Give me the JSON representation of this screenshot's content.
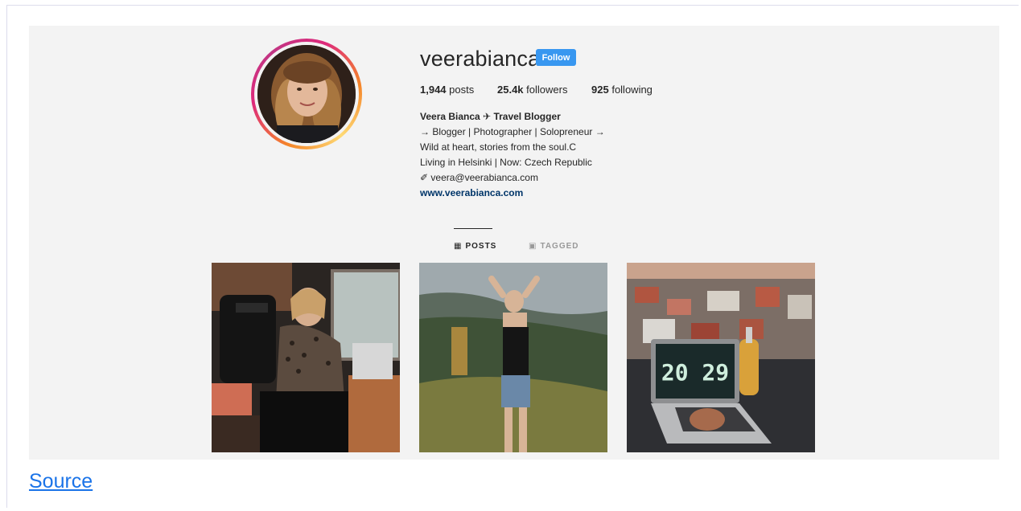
{
  "profile": {
    "username": "veerabianca",
    "follow_label": "Follow",
    "stats": {
      "posts_count": "1,944",
      "posts_label": "posts",
      "followers_count": "25.4k",
      "followers_label": "followers",
      "following_count": "925",
      "following_label": "following"
    },
    "bio": {
      "name_line": "Veera Bianca ✈ Travel Blogger",
      "line1": "→ Blogger | Photographer | Solopreneur →",
      "line2": "Wild at heart, stories from the soul.C",
      "line3": "Living in Helsinki | Now: Czech Republic",
      "line4": "✐ veera@veerabianca.com",
      "website": "www.veerabianca.com"
    }
  },
  "tabs": [
    {
      "label": "POSTS",
      "icon": "grid-icon",
      "active": true
    },
    {
      "label": "TAGGED",
      "icon": "tag-icon",
      "active": false
    }
  ],
  "photo_overlay_text": "20 29",
  "colors": {
    "follow_button": "#3897f0",
    "link": "#003569",
    "source_link": "#1a73e8"
  },
  "footer": {
    "source_label": "Source"
  }
}
